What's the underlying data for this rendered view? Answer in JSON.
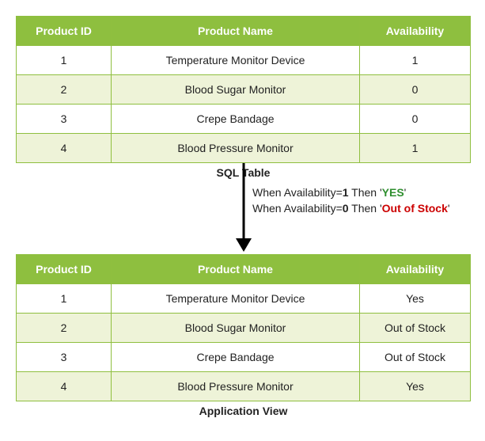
{
  "top_table": {
    "headers": [
      "Product ID",
      "Product Name",
      "Availability"
    ],
    "rows": [
      {
        "id": "1",
        "name": "Temperature Monitor Device",
        "avail": "1"
      },
      {
        "id": "2",
        "name": "Blood Sugar Monitor",
        "avail": "0"
      },
      {
        "id": "3",
        "name": "Crepe Bandage",
        "avail": "0"
      },
      {
        "id": "4",
        "name": "Blood Pressure Monitor",
        "avail": "1"
      }
    ],
    "caption": "SQL Table"
  },
  "rules": {
    "line1_pre": "When Availability=",
    "line1_val": "1",
    "line1_mid": " Then '",
    "line1_res": "YES",
    "line1_post": "'",
    "line2_pre": "When Availability=",
    "line2_val": "0",
    "line2_mid": " Then '",
    "line2_res": "Out of Stock",
    "line2_post": "'"
  },
  "bottom_table": {
    "headers": [
      "Product ID",
      "Product Name",
      "Availability"
    ],
    "rows": [
      {
        "id": "1",
        "name": "Temperature Monitor Device",
        "avail": "Yes"
      },
      {
        "id": "2",
        "name": "Blood Sugar Monitor",
        "avail": "Out of Stock"
      },
      {
        "id": "3",
        "name": "Crepe Bandage",
        "avail": "Out of Stock"
      },
      {
        "id": "4",
        "name": "Blood Pressure Monitor",
        "avail": "Yes"
      }
    ],
    "caption": "Application View"
  }
}
